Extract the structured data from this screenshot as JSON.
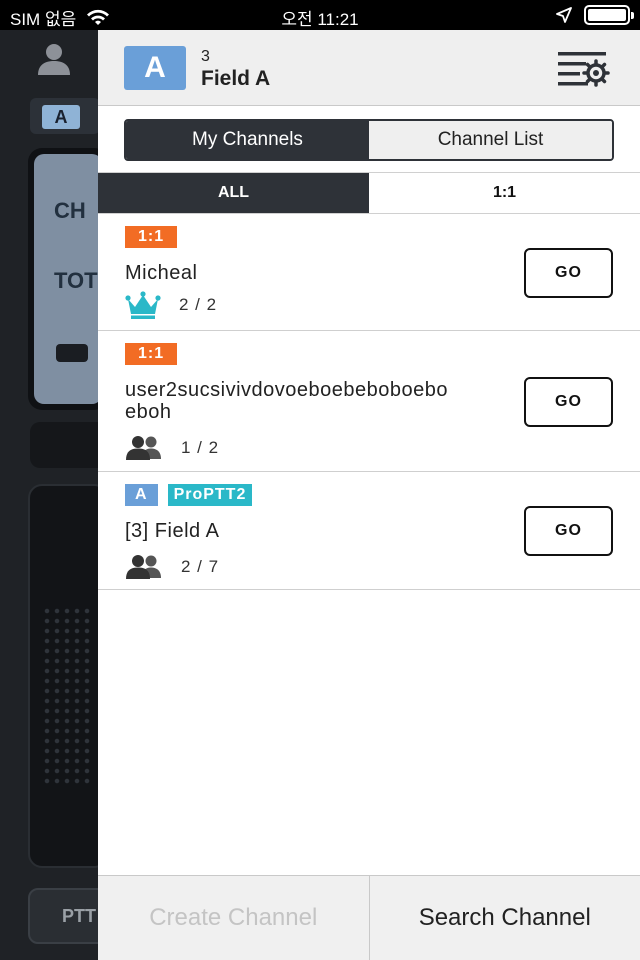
{
  "status_bar": {
    "carrier": "SIM 없음",
    "time": "오전 11:21",
    "battery_level": 1.0
  },
  "background_app": {
    "channel_badge": "A",
    "panel_line1": "CH",
    "panel_line2": "TOT",
    "ptt_label": "PTT"
  },
  "drawer": {
    "header": {
      "channel_badge": "A",
      "channel_number": "3",
      "channel_name": "Field A"
    },
    "segments": {
      "my_channels": "My Channels",
      "channel_list": "Channel List"
    },
    "filters": {
      "all": "ALL",
      "one_to_one": "1:1"
    },
    "channels": [
      {
        "tags": [
          "1:1"
        ],
        "name": "Micheal",
        "count": "2 / 2",
        "icon": "crown-icon",
        "go_label": "GO"
      },
      {
        "tags": [
          "1:1"
        ],
        "name_line1": "user2sucsivivdovoeboebeboboebo",
        "name_line2": "eboh",
        "count": "1 / 2",
        "icon": "users-icon",
        "go_label": "GO"
      },
      {
        "tags": [
          "A",
          "ProPTT2"
        ],
        "name": "[3] Field A",
        "count": "2 / 7",
        "icon": "users-icon",
        "go_label": "GO"
      }
    ],
    "bottom": {
      "create_channel": "Create Channel",
      "search_channel": "Search Channel"
    }
  },
  "colors": {
    "accent_dark": "#2e3238",
    "tag_orange": "#f26c24",
    "tag_blue": "#6a9fd8",
    "tag_teal": "#2ab8c8",
    "crown_teal": "#2ab8c8"
  }
}
